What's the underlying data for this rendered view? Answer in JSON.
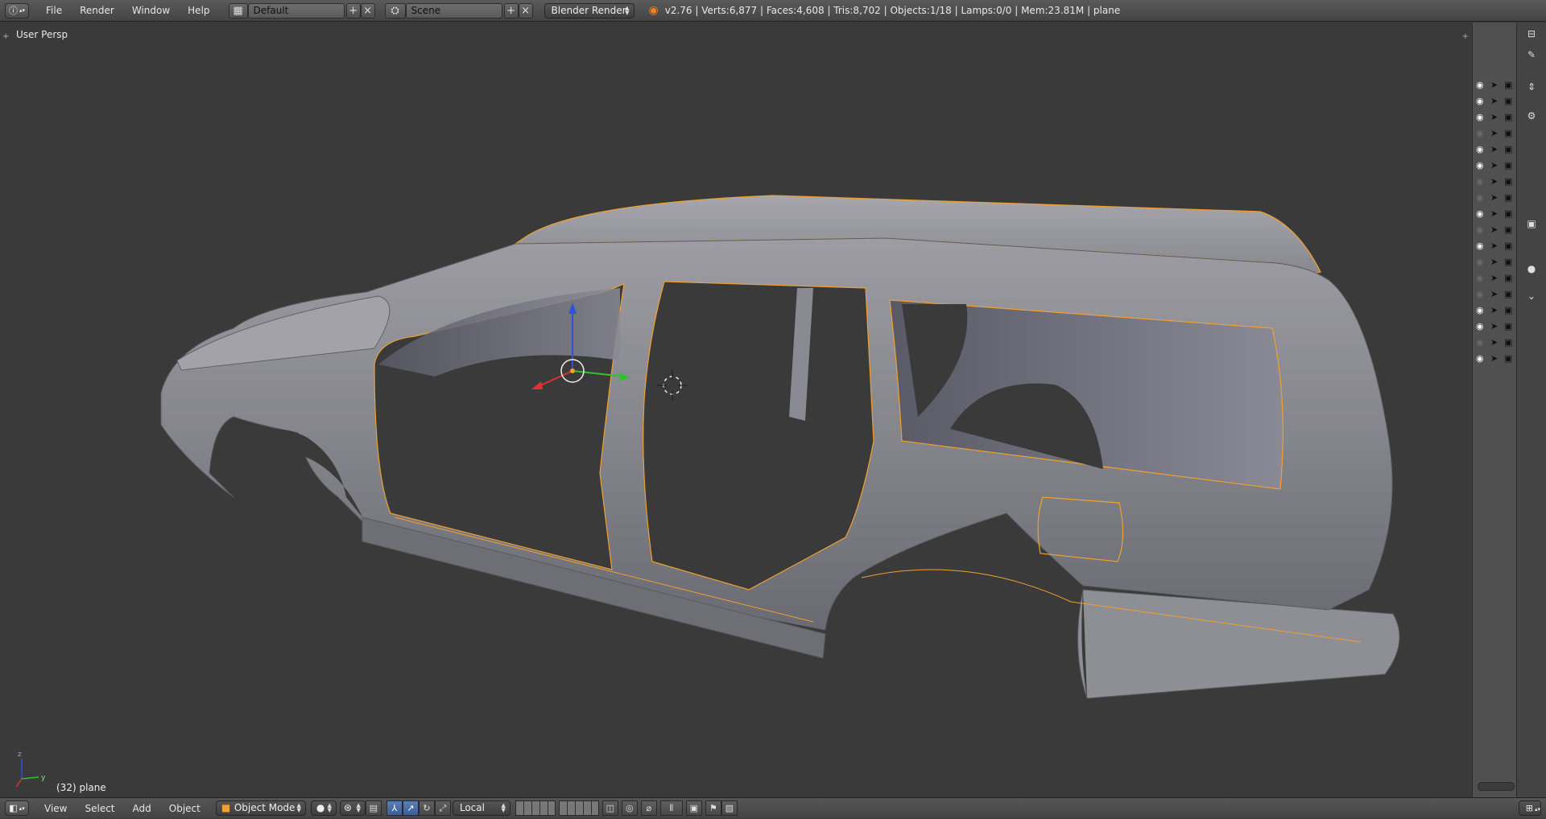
{
  "topbar": {
    "editor_icon": "info-icon",
    "menus": [
      "File",
      "Render",
      "Window",
      "Help"
    ],
    "layout_value": "Default",
    "scene_value": "Scene",
    "engine_value": "Blender Render",
    "stats": "v2.76 | Verts:6,877 | Faces:4,608 | Tris:8,702 | Objects:1/18 | Lamps:0/0 | Mem:23.81M | plane"
  },
  "viewport": {
    "view_label": "User Persp",
    "object_label": "(32) plane",
    "colors": {
      "background": "#3a3a3a",
      "body": "#8a8a8f",
      "selection_outline": "#f0a030",
      "axis_x": "#e03030",
      "axis_y": "#30c030",
      "axis_z": "#3050e0"
    }
  },
  "outliner": {
    "rows": [
      {
        "visible": true
      },
      {
        "visible": true
      },
      {
        "visible": true
      },
      {
        "visible": false
      },
      {
        "visible": true
      },
      {
        "visible": true
      },
      {
        "visible": false
      },
      {
        "visible": false
      },
      {
        "visible": true
      },
      {
        "visible": false
      },
      {
        "visible": true
      },
      {
        "visible": false
      },
      {
        "visible": false
      },
      {
        "visible": false
      },
      {
        "visible": true
      },
      {
        "visible": true
      },
      {
        "visible": false
      },
      {
        "visible": true
      }
    ]
  },
  "bottombar": {
    "menus": [
      "View",
      "Select",
      "Add",
      "Object"
    ],
    "mode_value": "Object Mode",
    "pivot_space_value": "Local"
  }
}
